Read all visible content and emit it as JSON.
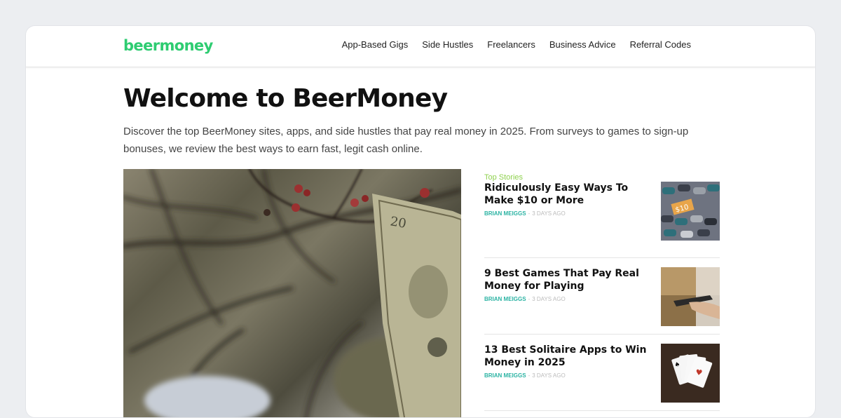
{
  "site": {
    "logo": "beermoney"
  },
  "nav": {
    "items": [
      {
        "label": "App-Based Gigs"
      },
      {
        "label": "Side Hustles"
      },
      {
        "label": "Freelancers"
      },
      {
        "label": "Business Advice"
      },
      {
        "label": "Referral Codes"
      }
    ]
  },
  "hero": {
    "title": "Welcome to BeerMoney",
    "intro": "Discover the top BeerMoney sites, apps, and side hustles that pay real money in 2025. From surveys to games to sign-up bonuses, we review the best ways to earn fast, legit cash online."
  },
  "sidebar": {
    "label": "Top Stories",
    "stories": [
      {
        "title": "Ridiculously Easy Ways To Make $10 or More",
        "author": "Brian Meiggs",
        "date": "3 days ago",
        "thumb_text": "$10"
      },
      {
        "title": "9 Best Games That Pay Real Money for Playing",
        "author": "Brian Meiggs",
        "date": "3 days ago"
      },
      {
        "title": "13 Best Solitaire Apps to Win Money in 2025",
        "author": "Brian Meiggs",
        "date": "3 days ago"
      }
    ]
  },
  "colors": {
    "brand": "#2ecc71",
    "accent_label": "#8fd14f",
    "author": "#2bb3a3"
  }
}
